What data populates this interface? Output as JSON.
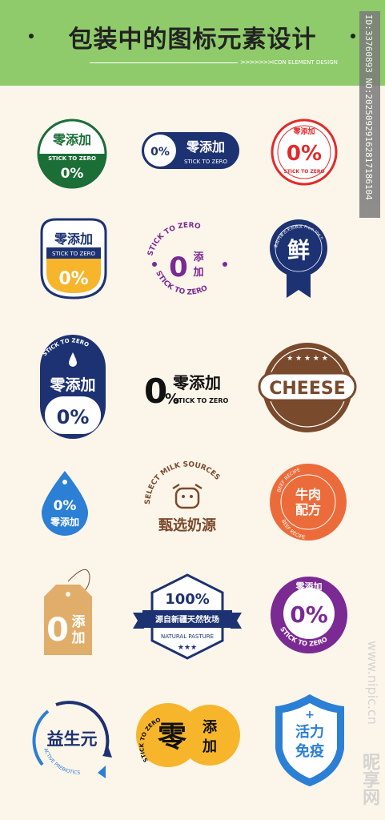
{
  "header": {
    "title": "包装中的图标元素设计",
    "arrows": ">>>>>>>",
    "subtitle": "ICON ELEMENT DESIGN"
  },
  "id_tag": "ID:33760893 NO:20250929162817186104",
  "watermark": {
    "url": "www.nipic.cn",
    "brand": "昵享网"
  },
  "colors": {
    "header_bg": "#8fcb6a",
    "page_bg": "#fcf5ea",
    "green": "#1b6e36",
    "navy": "#1d3272",
    "red": "#e12b2b",
    "purple": "#7b2a94",
    "brown": "#7a4a2c",
    "orange": "#ec6b3a",
    "blue": "#2b7fd4",
    "yellow": "#f7b52b",
    "tan": "#e0ae6a"
  },
  "badges": {
    "b1": {
      "top": "零添加",
      "mid": "STICK TO ZERO",
      "pct": "0%"
    },
    "b2": {
      "pct": "0%",
      "main": "零添加",
      "sub": "STICK TO ZERO"
    },
    "b3": {
      "top": "零添加",
      "pct": "0%",
      "sub": "STICK TO ZERO"
    },
    "b4": {
      "top": "零添加",
      "mid": "STICK TO ZERO",
      "pct": "0%"
    },
    "b5": {
      "arc_top": "STICK TO ZERO",
      "zero": "0",
      "tian": "添",
      "jia": "加",
      "arc_bottom": "STICK TO ZERO"
    },
    "b6": {
      "arc": "来自内蒙古天然牧区 From the natural pastoral area of Inner Mongolia",
      "main": "鲜"
    },
    "b7": {
      "arc": "STICK TO ZERO",
      "main": "零添加",
      "pct": "0%"
    },
    "b8": {
      "zero": "0",
      "pct": "%",
      "main": "零添加",
      "sub": "STICK TO ZERO"
    },
    "b9": {
      "main": "CHEESE"
    },
    "b10": {
      "pct": "0%",
      "main": "零添加"
    },
    "b11": {
      "arc": "SELECT MILK SOURCES",
      "main": "甄选奶源"
    },
    "b12": {
      "arc_top": "BEEF RECIPE",
      "line1": "牛肉",
      "line2": "配方",
      "arc_bottom": "BEEF RECIPE"
    },
    "b13": {
      "zero": "0",
      "tian": "添",
      "jia": "加"
    },
    "b14": {
      "pct": "100%",
      "ribbon": "源自新疆天然牧场",
      "sub": "NATURAL PASTURE",
      "stars": "★★★"
    },
    "b15": {
      "top": "零添加",
      "pct": "0%",
      "arc": "STICK TO ZERO"
    },
    "b16": {
      "main": "益生元",
      "arc": "ACTIVE PREBIOTICS"
    },
    "b17": {
      "arc": "STICK TO ZERO",
      "ling": "零",
      "tian": "添",
      "jia": "加"
    },
    "b18": {
      "plus": "+",
      "line1": "活力",
      "line2": "免疫"
    }
  }
}
